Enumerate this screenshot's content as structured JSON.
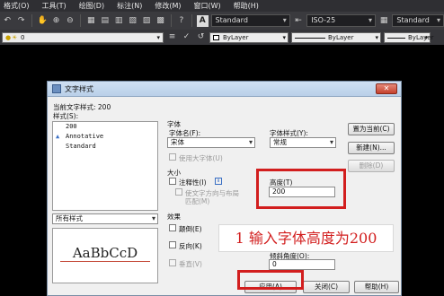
{
  "menubar": {
    "items": [
      "格式(O)",
      "工具(T)",
      "绘图(D)",
      "标注(N)",
      "修改(M)",
      "窗口(W)",
      "帮助(H)"
    ]
  },
  "toolbar": {
    "text_style_value": "Standard",
    "dim_style_value": "ISO-25",
    "table_style_value": "Standard",
    "layer_value": "0",
    "color_value": "ByLayer",
    "linetype_value": "ByLayer",
    "lineweight_value": "ByLayer"
  },
  "dialog": {
    "title": "文字样式",
    "current_style_label": "当前文字样式: 200",
    "styles_label": "样式(S):",
    "styles": [
      {
        "name": "200",
        "annotative": false
      },
      {
        "name": "Annotative",
        "annotative": true
      },
      {
        "name": "Standard",
        "annotative": false
      }
    ],
    "filter_value": "所有样式",
    "preview_text": "AaBbCcD",
    "font_group_label": "字体",
    "font_name_label": "字体名(F):",
    "font_name_value": "宋体",
    "font_style_label": "字体样式(Y):",
    "font_style_value": "常规",
    "use_big_font_label": "使用大字体(U)",
    "size_group_label": "大小",
    "annotative_label": "注释性(I)",
    "match_orientation_label_1": "使文字方向与布局",
    "match_orientation_label_2": "匹配(M)",
    "height_label": "高度(T)",
    "height_value": "200",
    "effects_group_label": "效果",
    "upside_down_label": "颠倒(E)",
    "backwards_label": "反向(K)",
    "vertical_label": "垂直(V)",
    "oblique_label": "倾斜角度(O):",
    "oblique_value": "0",
    "set_current_button": "置为当前(C)",
    "new_button": "新建(N)...",
    "delete_button": "删除(D)",
    "apply_button": "应用(A)",
    "close_button": "关闭(C)",
    "help_button": "帮助(H)"
  },
  "annotation": {
    "callout_text": "1 输入字体高度为200",
    "highlight_color": "#d21e1e"
  }
}
